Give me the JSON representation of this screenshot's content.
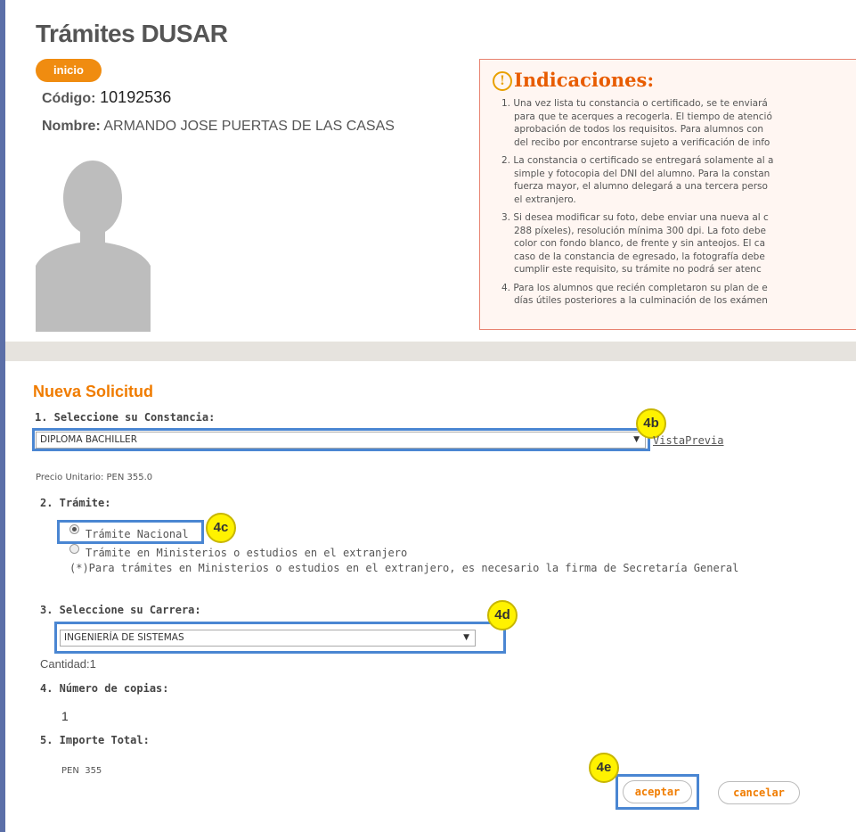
{
  "header": {
    "title": "Trámites DUSAR",
    "inicio_label": "inicio",
    "codigo_label": "Código:",
    "codigo_value": "10192536",
    "nombre_label": "Nombre:",
    "nombre_value": "ARMANDO JOSE PUERTAS DE LAS CASAS"
  },
  "indicaciones": {
    "title": "Indicaciones:",
    "items": [
      [
        "1. Una vez lista tu constancia o certificado, se te enviará",
        "para que te acerques a recogerla. El tiempo de atenció",
        "aprobación de todos los requisitos. Para alumnos con",
        "del recibo por encontrarse sujeto a verificación de info"
      ],
      [
        "2. La constancia o certificado se entregará solamente al a",
        "simple y fotocopia del DNI del alumno. Para la constan",
        "fuerza mayor, el alumno delegará a una tercera perso",
        "el extranjero."
      ],
      [
        "3. Si desea modificar su foto, debe enviar una nueva al c",
        "288 píxeles), resolución mínima 300 dpi. La foto debe",
        "color con fondo blanco, de frente y sin anteojos. El ca",
        "caso de la constancia de egresado, la fotografía debe",
        "cumplir este requisito, su trámite no podrá ser atenc"
      ],
      [
        "4. Para los alumnos que recién completaron su plan de e",
        "días útiles posteriores a la culminación de los exámen"
      ]
    ]
  },
  "form": {
    "title": "Nueva Solicitud",
    "step1_label": "1. Seleccione su Constancia:",
    "constancia_value": "DIPLOMA BACHILLER",
    "vista_previa": "VistaPrevia",
    "precio_label": "Precio Unitario: PEN",
    "precio_value": "355.0",
    "step2_label": "2. Trámite:",
    "tramite_nacional": "Trámite Nacional",
    "tramite_extranjero": "Trámite en Ministerios o estudios en el extranjero",
    "tramite_note": "(*)Para trámites en Ministerios o estudios en el extranjero, es necesario la firma de Secretaría General",
    "step3_label": "3. Seleccione su Carrera:",
    "carrera_value": "INGENIERÍA DE SISTEMAS",
    "cantidad_label": "Cantidad:",
    "cantidad_value": "1",
    "step4_label": "4. Número de copias:",
    "copias_value": "1",
    "step5_label": "5. Importe Total:",
    "importe_currency": "PEN",
    "importe_value": "355",
    "aceptar_label": "aceptar",
    "cancelar_label": "cancelar"
  },
  "annotations": {
    "b": "4b",
    "c": "4c",
    "d": "4d",
    "e": "4e"
  },
  "colors": {
    "accent": "#f07c00",
    "highlight": "#4a86d2",
    "badge": "#fff200"
  }
}
